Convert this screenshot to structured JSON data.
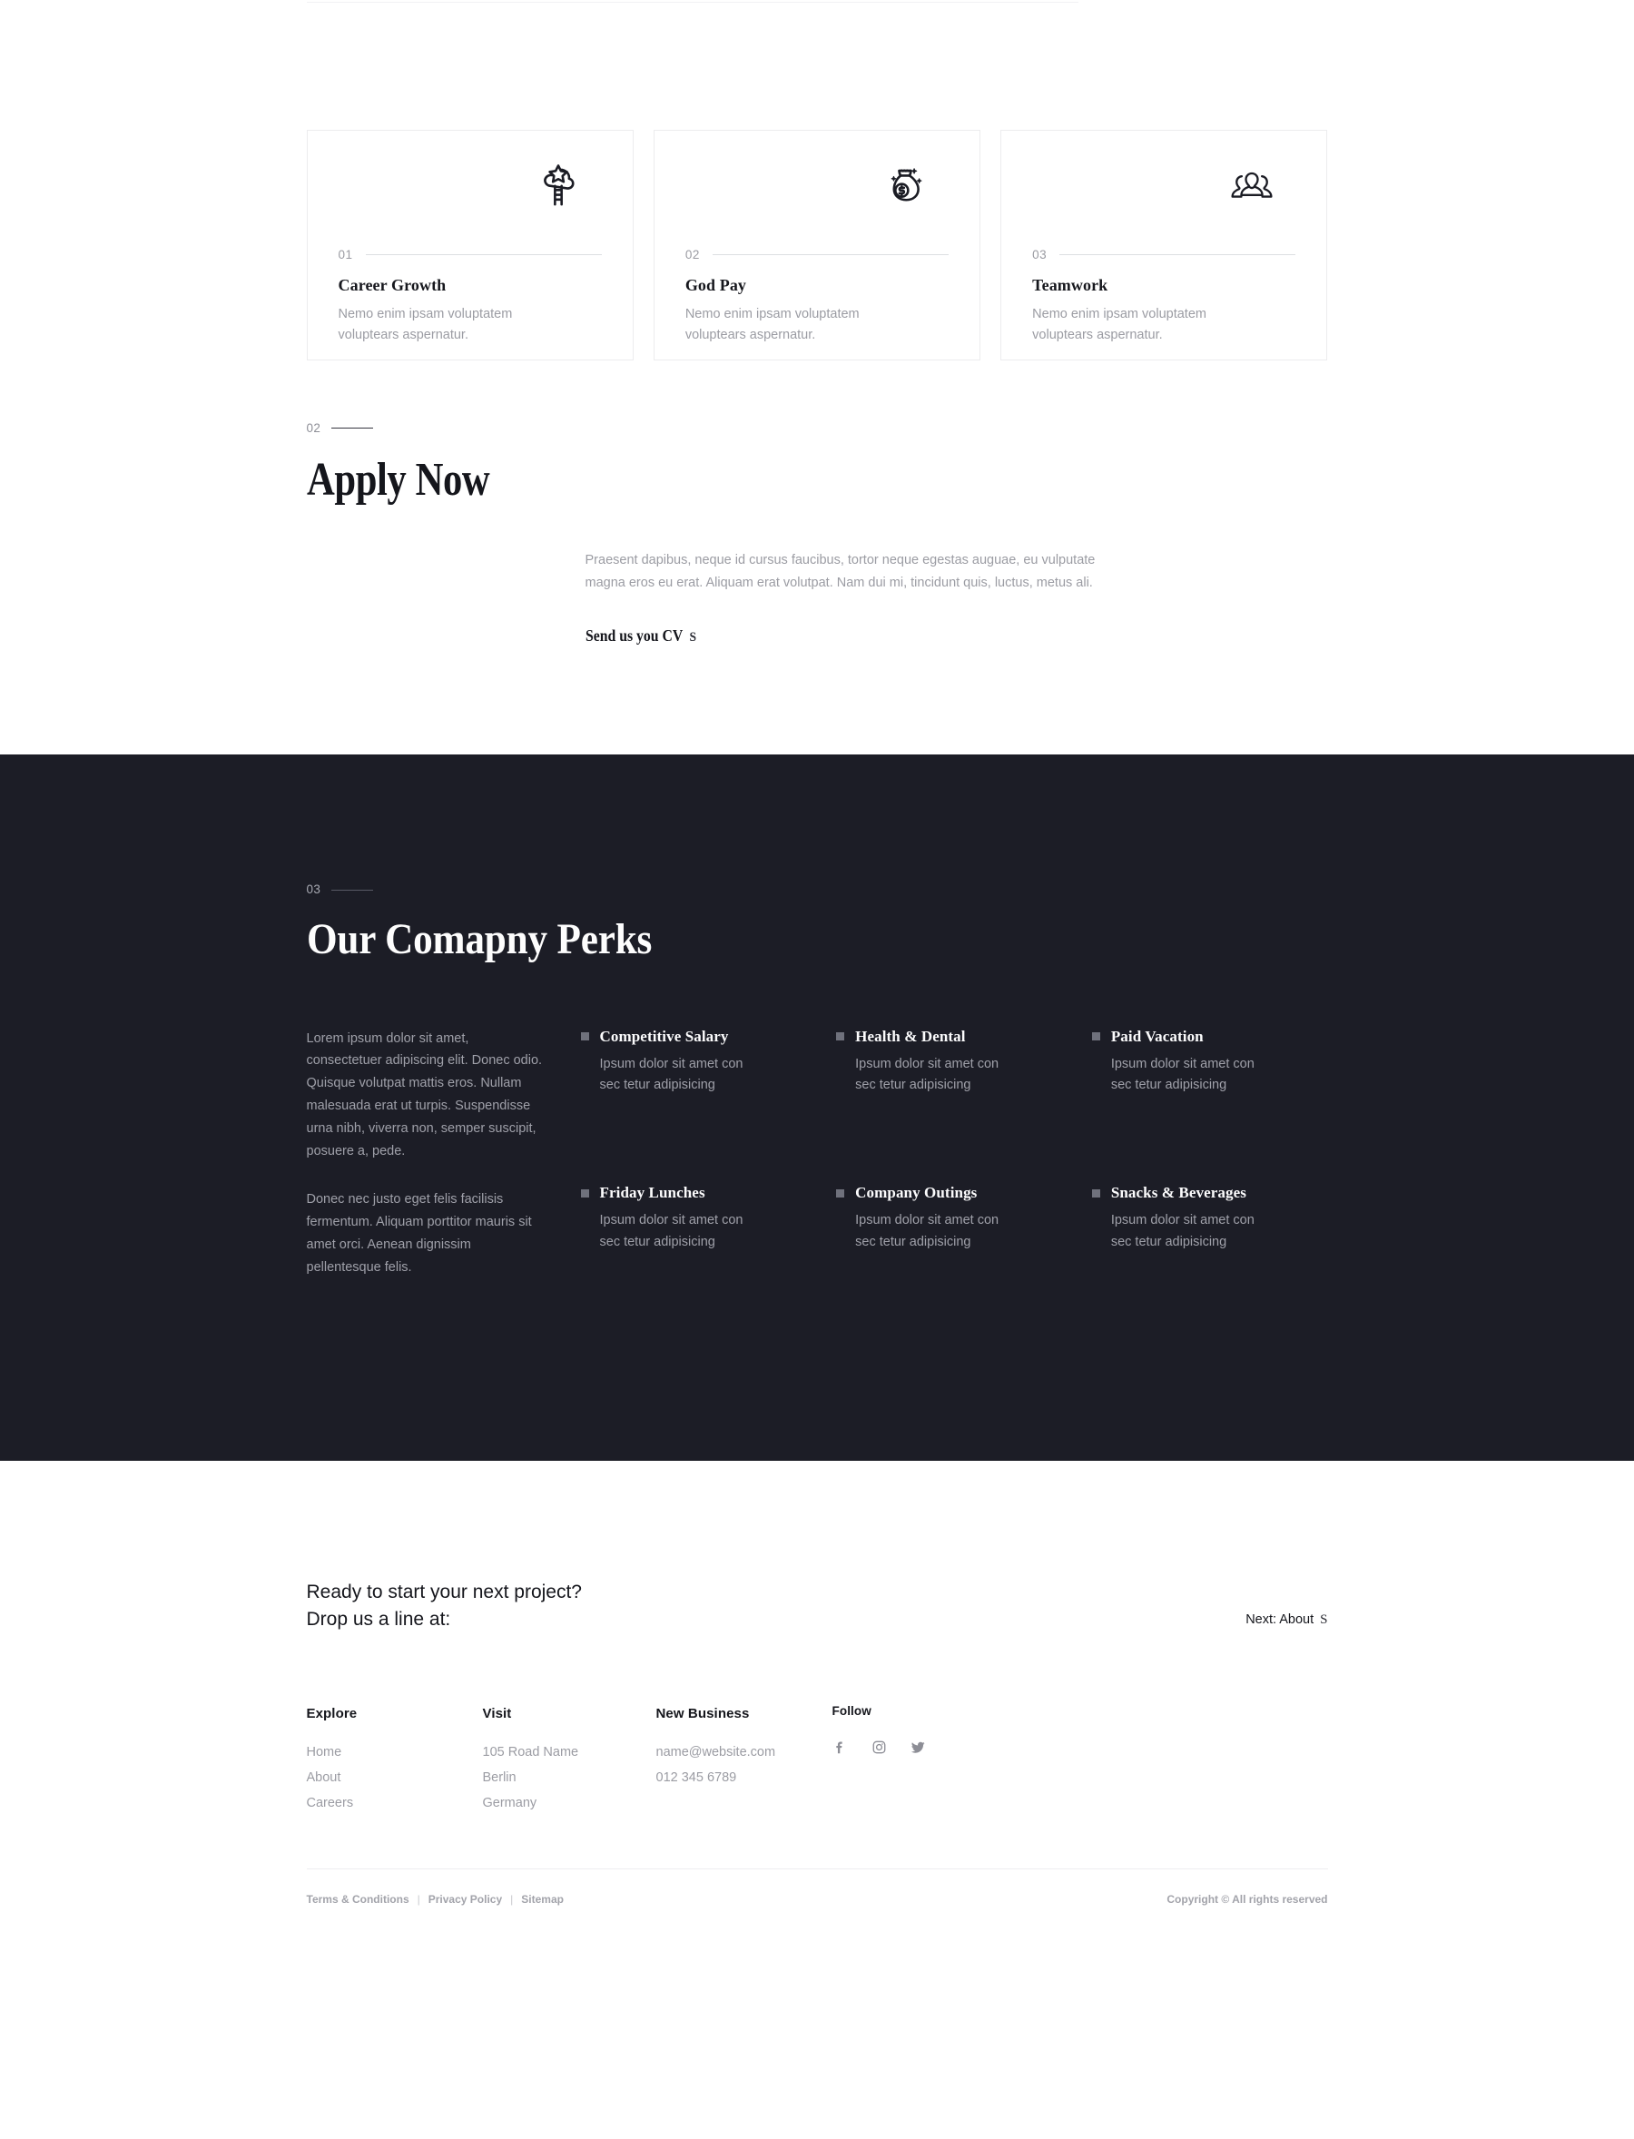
{
  "benefits": {
    "cards": [
      {
        "number": "01",
        "icon": "cloud-star-ladder-icon",
        "title": "Career Growth",
        "desc": "Nemo enim ipsam voluptatem voluptears aspernatur."
      },
      {
        "number": "02",
        "icon": "money-bag-icon",
        "title": "God Pay",
        "desc": "Nemo enim ipsam voluptatem voluptears aspernatur."
      },
      {
        "number": "03",
        "icon": "team-people-icon",
        "title": "Teamwork",
        "desc": "Nemo enim ipsam voluptatem voluptears aspernatur."
      }
    ]
  },
  "apply": {
    "eyebrow_number": "02",
    "title": "Apply Now",
    "paragraph": "Praesent dapibus, neque id cursus faucibus, tortor neque egestas auguae, eu vulputate magna eros eu erat. Aliquam erat volutpat. Nam dui mi, tincidunt quis, luctus, metus ali.",
    "link_label": "Send us you CV",
    "link_arrow": "S"
  },
  "perks": {
    "eyebrow_number": "03",
    "title": "Our Comapny Perks",
    "paragraphs": [
      "Lorem ipsum dolor sit amet, consectetuer adipiscing elit. Donec odio. Quisque volutpat mattis eros. Nullam malesuada erat ut turpis. Suspendisse urna nibh, viverra non, semper suscipit, posuere a, pede.",
      "Donec nec justo eget felis facilisis fermentum. Aliquam porttitor mauris sit amet orci. Aenean dignissim pellentesque felis."
    ],
    "items": [
      {
        "title": "Competitive Salary",
        "desc": "Ipsum dolor sit amet con sec tetur adipisicing"
      },
      {
        "title": "Health & Dental",
        "desc": "Ipsum dolor sit amet con sec tetur adipisicing"
      },
      {
        "title": "Paid Vacation",
        "desc": "Ipsum dolor sit amet con sec tetur adipisicing"
      },
      {
        "title": "Friday Lunches",
        "desc": "Ipsum dolor sit amet con sec tetur adipisicing"
      },
      {
        "title": "Company Outings",
        "desc": "Ipsum dolor sit amet con sec tetur adipisicing"
      },
      {
        "title": "Snacks & Beverages",
        "desc": "Ipsum dolor sit amet con sec tetur adipisicing"
      }
    ]
  },
  "cta": {
    "line1": "Ready to start your next project?",
    "line2": "Drop us a line at:",
    "next_label": "Next: About",
    "next_arrow": "S"
  },
  "footer": {
    "explore": {
      "title": "Explore",
      "links": [
        "Home",
        "About",
        "Careers"
      ]
    },
    "visit": {
      "title": "Visit",
      "lines": [
        "105 Road Name",
        "Berlin",
        "Germany"
      ]
    },
    "new_business": {
      "title": "New Business",
      "lines": [
        "name@website.com",
        "012 345 6789"
      ]
    },
    "follow": {
      "title": "Follow",
      "socials": [
        "facebook-icon",
        "instagram-icon",
        "twitter-icon"
      ]
    },
    "legal": {
      "terms": "Terms & Conditions",
      "privacy": "Privacy Policy",
      "sitemap": "Sitemap",
      "separator": "|",
      "copyright": "Copyright © All rights reserved"
    }
  },
  "colors": {
    "dark_bg": "#1c1d26",
    "ink": "#15161c",
    "muted": "#9b9ca3",
    "rule": "#ececee"
  }
}
